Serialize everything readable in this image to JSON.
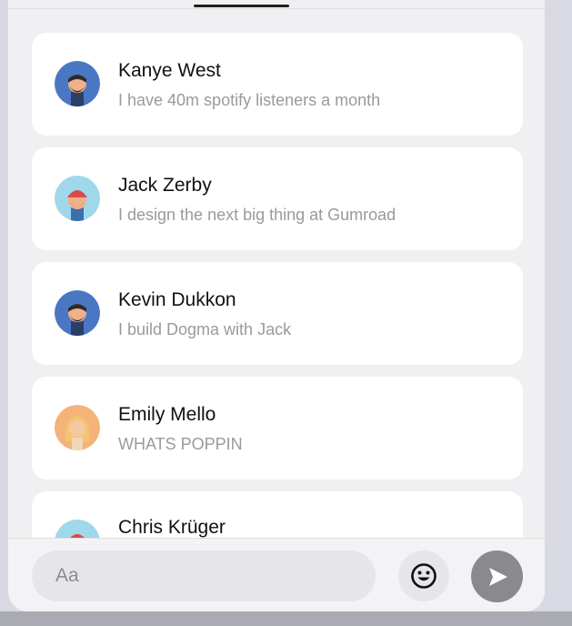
{
  "conversations": [
    {
      "name": "Kanye West",
      "message": "I have 40m spotify listeners a month",
      "avatar": "bearded-man-avatar-icon",
      "avatar_color": "#4a77c4"
    },
    {
      "name": "Jack Zerby",
      "message": "I design the next big thing at Gumroad",
      "avatar": "red-beanie-man-avatar-icon",
      "avatar_color": "#9fd8ea"
    },
    {
      "name": "Kevin Dukkon",
      "message": "I build Dogma with Jack",
      "avatar": "bearded-man-avatar-icon",
      "avatar_color": "#4a77c4"
    },
    {
      "name": "Emily Mello",
      "message": "WHATS POPPIN",
      "avatar": "woman-avatar-icon",
      "avatar_color": "#f5b37a"
    },
    {
      "name": "Chris Krüger",
      "message": "",
      "avatar": "red-beanie-man-avatar-icon",
      "avatar_color": "#9fd8ea"
    }
  ],
  "composer": {
    "placeholder": "Aa",
    "emoji_icon": "smiley-icon",
    "send_icon": "send-arrow-icon"
  }
}
